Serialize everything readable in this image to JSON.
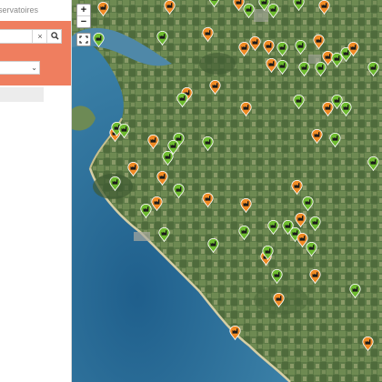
{
  "panel": {
    "title": "servatoires",
    "search_value": "",
    "clear_glyph": "×",
    "select_value": "",
    "caret_glyph": "⌄"
  },
  "map": {
    "zoom_in": "+",
    "zoom_out": "−",
    "colors": {
      "sea": "#2e6f98",
      "land": "#5f7d4a",
      "orange_marker": "#f08a24",
      "green_marker": "#6dbb2f",
      "panel_accent": "#ef7e5f"
    }
  }
}
